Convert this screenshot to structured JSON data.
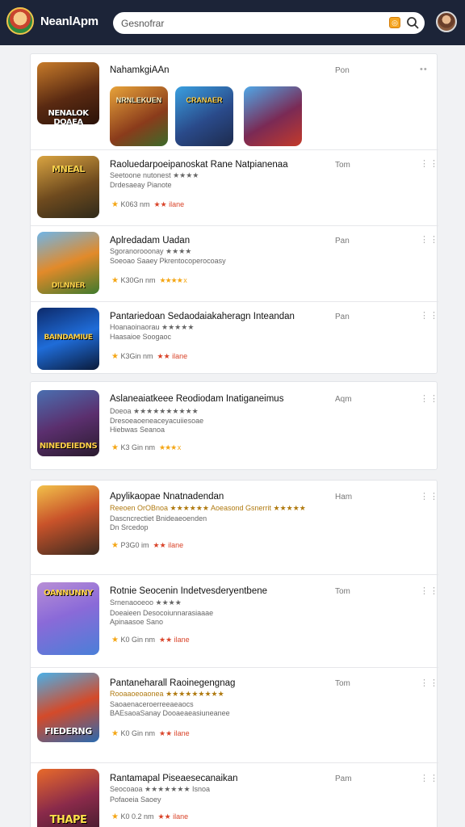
{
  "header": {
    "app_title": "NeanlApm",
    "search_placeholder": "Gesnofrar",
    "coin_symbol": "◎",
    "icons": {
      "logo": "app-logo",
      "coin": "coin-icon",
      "search": "search-icon",
      "avatar": "user-avatar"
    }
  },
  "featured": {
    "title": "NahamkgiAAn",
    "time": "Pon",
    "cover_text": "NENALOK DOAEA",
    "minis": [
      "NRNLEKUEN",
      "CRANAER",
      ""
    ]
  },
  "list1": [
    {
      "title": "Raoluedarpoeipanoskat Rane Natpianenaa",
      "sub1": "Seetoone nutonest ★★★★",
      "sub2": "Drdesaeay Pianote",
      "meta_count": "K063 nm",
      "meta_rating": "★★ ilane",
      "time": "Tom",
      "cover": "MNEAL"
    },
    {
      "title": "Aplredadam Uadan",
      "sub1": "Sgoranorooonay ★★★★",
      "sub2": "Soeoao Saaey Pkrentocoperocoasy",
      "meta_count": "K30Gn nm",
      "meta_rating": "★★★★ x",
      "time": "Pan",
      "cover": "DILNNER"
    },
    {
      "title": "Pantariedoan Sedaodaiakaheragn Inteandan",
      "sub1": "Hoanaoinaorau ★★★★★",
      "sub2": "Haasaioe Soogaoc",
      "meta_count": "K3Gin nm",
      "meta_rating": "★★ ilane",
      "time": "Pan",
      "cover": "BAINDAMIUE"
    }
  ],
  "list2": [
    {
      "title": "Aslaneaiatkeee Reodiodam Inatiganeimus",
      "sub1": "Doeoa ★★★★★★★★★★",
      "sub2": "Dresoeaoeneaceyacuiiesoae",
      "sub3": "Hiebwas Seanoa",
      "meta_count": "K3 Gin nm",
      "meta_rating": "★★★ x",
      "time": "Aqm",
      "cover": "NINEDEIEDNS"
    }
  ],
  "list3": [
    {
      "title": "Apylikaopae Nnatnadendan",
      "sub1": "Reeoen OrOBnoa ★★★★★★ Aoeasond Gsnerrit ★★★★★",
      "sub2": "Dascncrectiet Bnideaeoenden",
      "sub3": "Dn Srcedop",
      "meta_count": "P3G0 im",
      "meta_rating": "★★ ilane",
      "time": "Ham",
      "cover": ""
    },
    {
      "title": "Rotnie Seocenin Indetvesderyentbene",
      "sub1": "Srnenaooeoo ★★★★",
      "sub2": "Doeaieen Desocoiunnarasiaaae",
      "sub3": "Apinaasoe Sano",
      "meta_count": "K0 Gin nm",
      "meta_rating": "★★ ilane",
      "time": "Tom",
      "cover": "OANNUNNY"
    },
    {
      "title": "Pantaneharall Raoinegengnag",
      "sub1": "Rooaaoeoaonea ★★★★★★★★★",
      "sub2": "Saoaenaceroerreeaeaocs",
      "sub3": "BAEsaoaSanay Dooaeaeasiuneanee",
      "meta_count": "K0 Gin nm",
      "meta_rating": "★★ ilane",
      "time": "Tom",
      "cover": "FIEDERNG"
    },
    {
      "title": "Rantamapal Piseaesecanaikan",
      "sub1": "Seocoaoa ★★★★★★★ Isnoa",
      "sub2": "Pofaoeia Saoey",
      "meta_count": "K0 0.2 nm",
      "meta_rating": "★★ ilane",
      "time": "Pam",
      "cover": "THAPE"
    }
  ],
  "colors": {
    "topbar": "#1c2438",
    "star": "#f4a615",
    "rating_red": "#d9442a"
  }
}
